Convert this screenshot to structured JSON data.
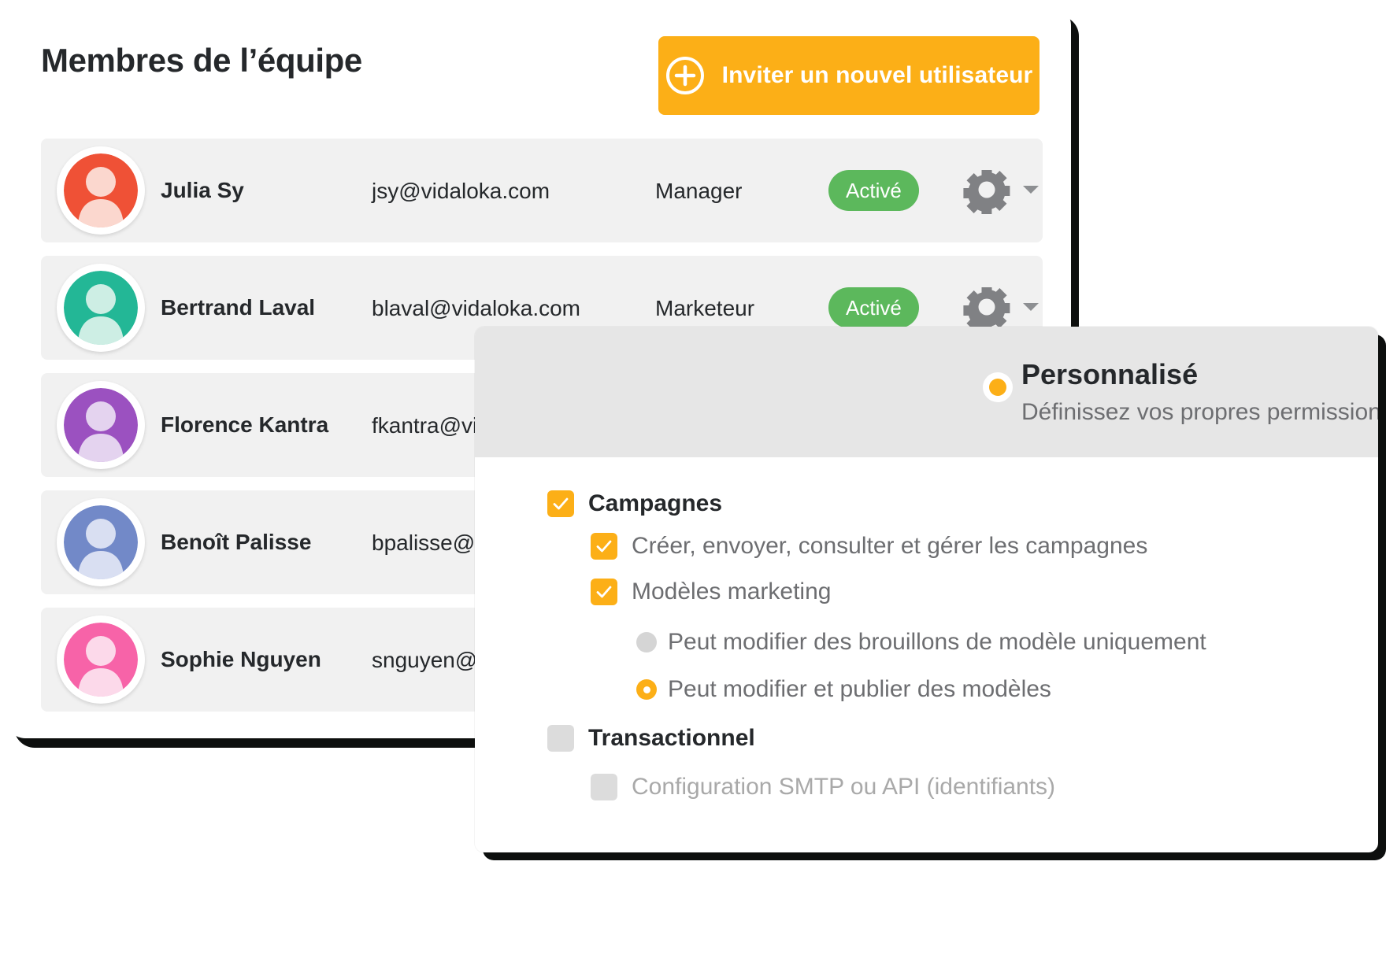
{
  "team": {
    "title": "Membres de l’équipe",
    "invite_button": {
      "label": "Inviter un nouvel utilisateur",
      "icon": "plus-circle-icon",
      "color": "#fcaf17"
    },
    "members": [
      {
        "name": "Julia Sy",
        "email": "jsy@vidaloka.com",
        "role": "Manager",
        "status": "Activé",
        "status_color": "#5cb85c",
        "avatar_color": "#ef5136",
        "avatar_fg": "#fbd7ce"
      },
      {
        "name": "Bertrand Laval",
        "email": "blaval@vidaloka.com",
        "role": "Marketeur",
        "status": "Activé",
        "status_color": "#5cb85c",
        "avatar_color": "#23b796",
        "avatar_fg": "#cdeee4"
      },
      {
        "name": "Florence Kantra",
        "email": "fkantra@vida",
        "role": "",
        "status": "",
        "status_color": "#5cb85c",
        "avatar_color": "#9b51c0",
        "avatar_fg": "#e4d3ef"
      },
      {
        "name": "Benoît Palisse",
        "email": "bpalisse@vid",
        "role": "",
        "status": "",
        "status_color": "#5cb85c",
        "avatar_color": "#7289c8",
        "avatar_fg": "#d9dff2"
      },
      {
        "name": "Sophie Nguyen",
        "email": "snguyen@vid",
        "role": "",
        "status": "",
        "status_color": "#5cb85c",
        "avatar_color": "#f763a8",
        "avatar_fg": "#fcd9ea"
      }
    ],
    "row_action_icons": [
      "gear-icon",
      "chevron-down-icon"
    ]
  },
  "permissions_panel": {
    "header": {
      "radio_selected": true,
      "title": "Personnalisé",
      "subtitle": "Définissez vos propres permissions",
      "accent_color": "#fcaf17",
      "background": "#e6e6e6"
    },
    "items": [
      {
        "label": "Campagnes",
        "control": "checkbox",
        "checked": true
      },
      {
        "label": "Créer, envoyer, consulter et gérer les campagnes",
        "control": "checkbox",
        "checked": true
      },
      {
        "label": "Modèles marketing",
        "control": "checkbox",
        "checked": true
      },
      {
        "label": "Peut modifier des brouillons de modèle uniquement",
        "control": "radio",
        "checked": false
      },
      {
        "label": "Peut modifier et publier des modèles",
        "control": "radio",
        "checked": true
      },
      {
        "label": "Transactionnel",
        "control": "checkbox",
        "checked": false
      },
      {
        "label": "Configuration SMTP ou API (identifiants)",
        "control": "checkbox",
        "checked": false
      }
    ]
  }
}
